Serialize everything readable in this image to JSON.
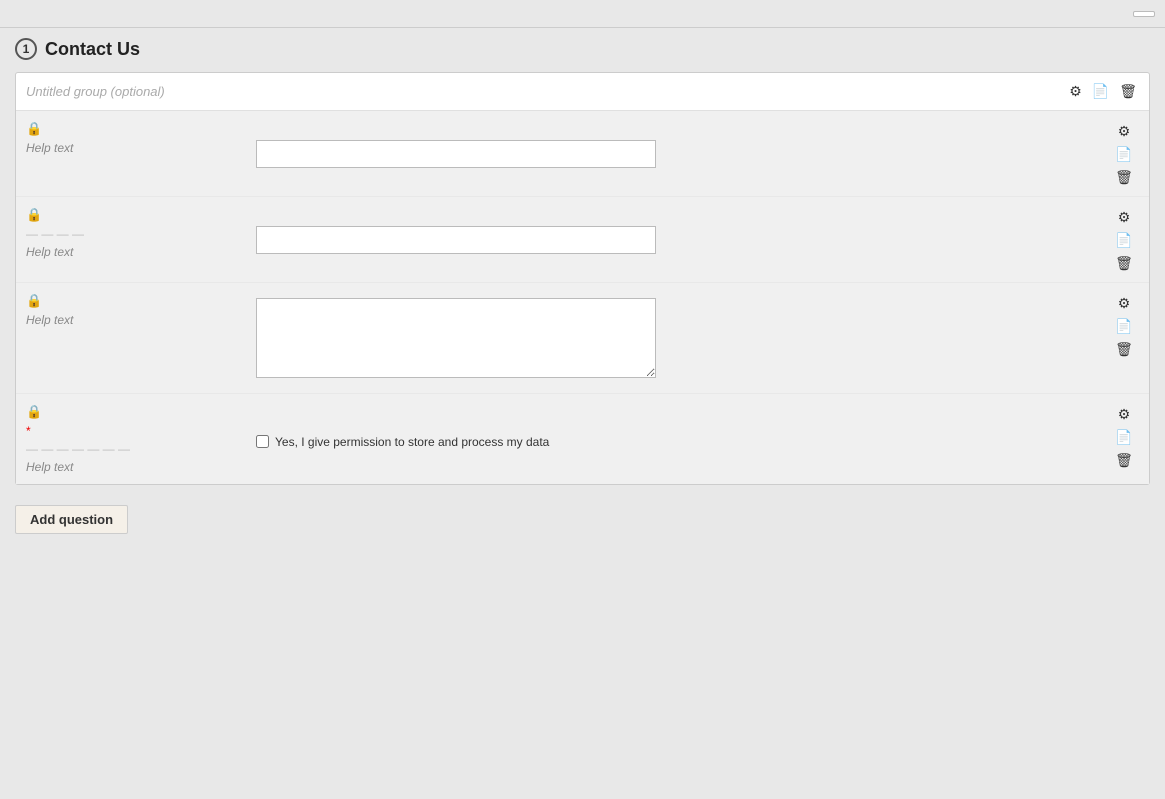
{
  "topBar": {
    "btnLabel": ""
  },
  "stepBadge": "1",
  "sectionTitle": "Contact Us",
  "group": {
    "titlePlaceholder": "Untitled group (optional)"
  },
  "questions": [
    {
      "id": "q1",
      "labelPlaceholder": "",
      "helpText": "Help text",
      "type": "text",
      "hasLock": true,
      "hasRequired": false,
      "hasLabelLine": false
    },
    {
      "id": "q2",
      "labelPlaceholder": "",
      "helpText": "Help text",
      "type": "text",
      "hasLock": true,
      "hasRequired": false,
      "hasLabelLine": true
    },
    {
      "id": "q3",
      "labelPlaceholder": "",
      "helpText": "Help text",
      "type": "textarea",
      "hasLock": true,
      "hasRequired": false,
      "hasLabelLine": false
    },
    {
      "id": "q4",
      "labelPlaceholder": "",
      "helpText": "Help text",
      "type": "checkbox",
      "checkboxLabel": "Yes, I give permission to store and process my data",
      "hasLock": true,
      "hasRequired": true,
      "hasLabelLine": true
    }
  ],
  "icons": {
    "gear": "⚙",
    "copy": "📄",
    "trash": "🗑",
    "lock": "🔒"
  },
  "addQuestionBtn": "Add question"
}
